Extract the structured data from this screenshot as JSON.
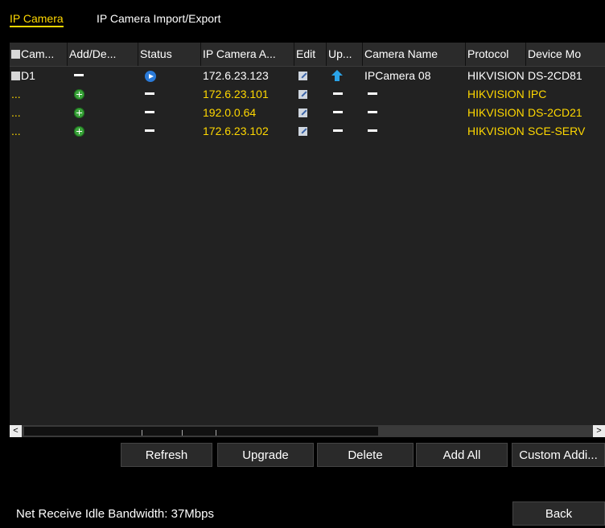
{
  "tabs": [
    {
      "label": "IP Camera",
      "active": true
    },
    {
      "label": "IP Camera Import/Export",
      "active": false
    }
  ],
  "table": {
    "headers": [
      "Cam...",
      "Add/De...",
      "Status",
      "IP Camera A...",
      "Edit",
      "Up...",
      "Camera Name",
      "Protocol",
      "Device Mo"
    ],
    "rows": [
      {
        "camera": "D1",
        "add_icon": "dash",
        "status_icon": "play-icon",
        "ip": "172.6.23.123",
        "edit_icon": "edit-icon",
        "upgrade_icon": "upgrade-icon",
        "name": "IPCamera 08",
        "protocol": "HIKVISION",
        "model": "DS-2CD81",
        "color": "white"
      },
      {
        "camera": "...",
        "add_icon": "add-icon",
        "status_icon": "dash",
        "ip": "172.6.23.101",
        "edit_icon": "edit-icon",
        "upgrade_icon": "dash",
        "name": "—",
        "protocol": "HIKVISION",
        "model": "IPC",
        "color": "yellow"
      },
      {
        "camera": "...",
        "add_icon": "add-icon",
        "status_icon": "dash",
        "ip": "192.0.0.64",
        "edit_icon": "edit-icon",
        "upgrade_icon": "dash",
        "name": "—",
        "protocol": "HIKVISION",
        "model": "DS-2CD21",
        "color": "yellow"
      },
      {
        "camera": "...",
        "add_icon": "add-icon",
        "status_icon": "dash",
        "ip": "172.6.23.102",
        "edit_icon": "edit-icon",
        "upgrade_icon": "dash",
        "name": "—",
        "protocol": "HIKVISION",
        "model": "SCE-SERV",
        "color": "yellow"
      }
    ]
  },
  "scrollbar": {
    "left_arrow": "<",
    "right_arrow": ">"
  },
  "buttons": {
    "refresh": "Refresh",
    "upgrade": "Upgrade",
    "delete": "Delete",
    "add_all": "Add All",
    "custom_adding": "Custom Addi...",
    "back": "Back"
  },
  "status": {
    "bandwidth": "Net Receive Idle Bandwidth: 37Mbps"
  },
  "colors": {
    "accent": "#ffd800",
    "background": "#000000",
    "table_bg": "#222222"
  }
}
